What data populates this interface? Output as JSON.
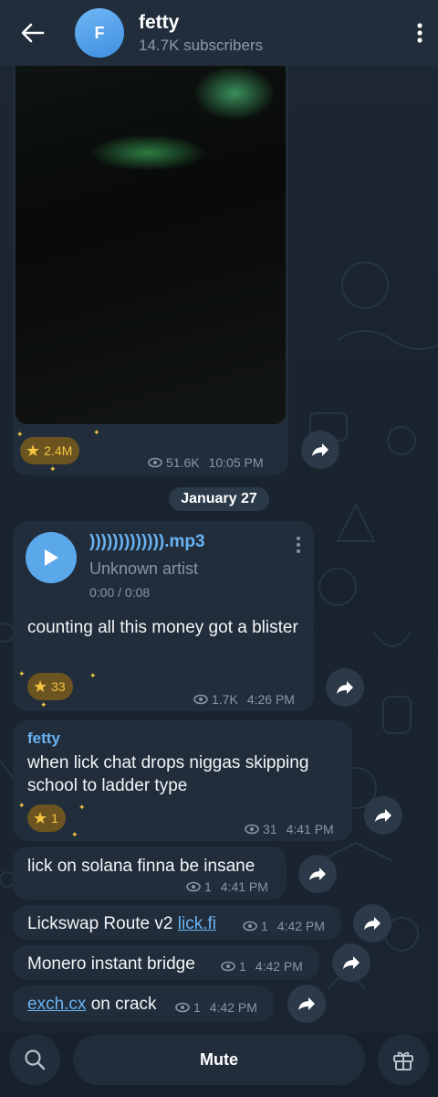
{
  "header": {
    "avatar_letter": "F",
    "title": "fetty",
    "subtitle": "14.7K subscribers"
  },
  "video_post": {
    "reaction_count": "2.4M",
    "views": "51.6K",
    "time": "10:05 PM"
  },
  "date_separator": "January 27",
  "audio_post": {
    "file_name": "))))))))))))).mp3",
    "artist": "Unknown artist",
    "duration": "0:00 / 0:08",
    "caption": "counting all this money got a blister",
    "reaction_count": "33",
    "views": "1.7K",
    "time": "4:26 PM"
  },
  "post_3": {
    "author": "fetty",
    "text": "when lick chat drops niggas skipping school to ladder type",
    "reaction_count": "1",
    "views": "31",
    "time": "4:41 PM"
  },
  "post_4": {
    "text": "lick on solana finna be insane",
    "views": "1",
    "time": "4:41 PM"
  },
  "post_5": {
    "text": "Lickswap Route v2 ",
    "link": "lick.fi",
    "views": "1",
    "time": "4:42 PM"
  },
  "post_6": {
    "text": "Monero instant bridge",
    "views": "1",
    "time": "4:42 PM"
  },
  "post_7": {
    "link": "exch.cx",
    "text": " on crack",
    "views": "1",
    "time": "4:42 PM"
  },
  "bottom": {
    "mute_label": "Mute"
  },
  "colors": {
    "accent": "#5aa7ea",
    "link": "#6ab3f3",
    "star": "#f5c542",
    "bubble": "#212d3b"
  }
}
